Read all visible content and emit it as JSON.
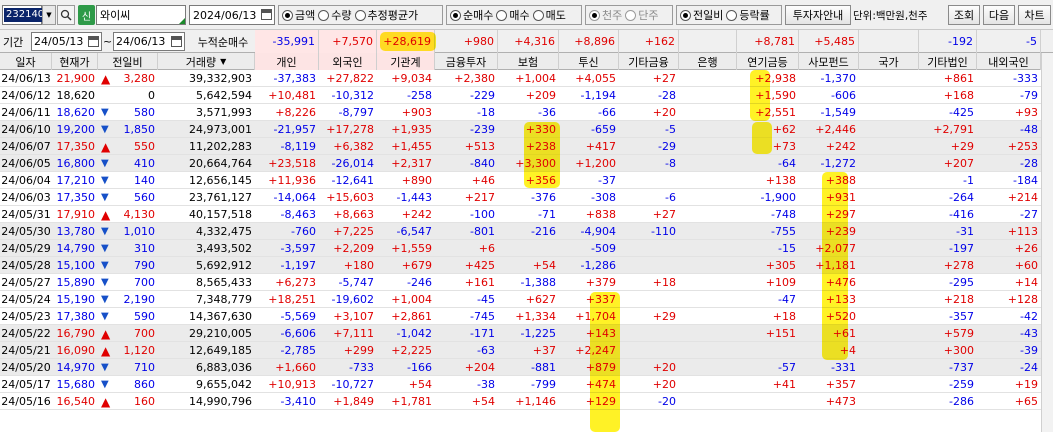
{
  "toolbar": {
    "code": "232140",
    "credit_badge": "신",
    "name": "와이씨",
    "date": "2024/06/13",
    "unit_radios": [
      {
        "label": "금액",
        "on": true
      },
      {
        "label": "수량",
        "on": false
      },
      {
        "label": "추정평균가",
        "on": false
      }
    ],
    "trade_radios": [
      {
        "label": "순매수",
        "on": true
      },
      {
        "label": "매수",
        "on": false
      },
      {
        "label": "매도",
        "on": false
      }
    ],
    "unit_radios2": [
      {
        "label": "천주",
        "on": true
      },
      {
        "label": "단주",
        "on": false
      }
    ],
    "compare_radios": [
      {
        "label": "전일비",
        "on": true
      },
      {
        "label": "등락률",
        "on": false
      }
    ],
    "investor_guide": "투자자안내",
    "unit_text": "단위:백만원,천주",
    "lookup": "조회",
    "next": "다음",
    "chart": "차트"
  },
  "period": {
    "label": "기간",
    "from": "24/05/13",
    "tilde": "~",
    "to": "24/06/13",
    "cumul_label": "누적순매수",
    "cumul": {
      "indiv": "-35,991",
      "foreign": "+7,570",
      "inst": "+28,619",
      "fininv": "+980",
      "insur": "+4,316",
      "trust": "+8,896",
      "etcfin": "+162",
      "bank": "",
      "pension": "+8,781",
      "pef": "+5,485",
      "nation": "",
      "etccorp": "-192",
      "dom": "-5"
    }
  },
  "columns": {
    "date": "일자",
    "price": "현재가",
    "change": "전일비",
    "volume": "거래량",
    "indiv": "개인",
    "foreign": "외국인",
    "inst": "기관계",
    "fininv": "금융투자",
    "insur": "보험",
    "trust": "투신",
    "etcfin": "기타금융",
    "bank": "은행",
    "pension": "연기금등",
    "pef": "사모펀드",
    "nation": "국가",
    "etccorp": "기타법인",
    "dom": "내외국인"
  },
  "rows": [
    {
      "date": "24/06/13",
      "price": "21,900",
      "dir": "up",
      "change": "3,280",
      "volume": "39,332,903",
      "indiv": "-37,383",
      "foreign": "+27,822",
      "inst": "+9,034",
      "fininv": "+2,380",
      "insur": "+1,004",
      "trust": "+4,055",
      "etcfin": "+27",
      "bank": "",
      "pension": "+2,938",
      "pef": "-1,370",
      "nation": "",
      "etccorp": "+861",
      "dom": "-333"
    },
    {
      "date": "24/06/12",
      "price": "18,620",
      "dir": "none",
      "change": "0",
      "volume": "5,642,594",
      "indiv": "+10,481",
      "foreign": "-10,312",
      "inst": "-258",
      "fininv": "-229",
      "insur": "+209",
      "trust": "-1,194",
      "etcfin": "-28",
      "bank": "",
      "pension": "+1,590",
      "pef": "-606",
      "nation": "",
      "etccorp": "+168",
      "dom": "-79"
    },
    {
      "date": "24/06/11",
      "price": "18,620",
      "dir": "down",
      "change": "580",
      "volume": "3,571,993",
      "indiv": "+8,226",
      "foreign": "-8,797",
      "inst": "+903",
      "fininv": "-18",
      "insur": "-36",
      "trust": "-66",
      "etcfin": "+20",
      "bank": "",
      "pension": "+2,551",
      "pef": "-1,549",
      "nation": "",
      "etccorp": "-425",
      "dom": "+93"
    },
    {
      "date": "24/06/10",
      "price": "19,200",
      "dir": "down",
      "change": "1,850",
      "volume": "24,973,001",
      "indiv": "-21,957",
      "foreign": "+17,278",
      "inst": "+1,935",
      "fininv": "-239",
      "insur": "+330",
      "trust": "-659",
      "etcfin": "-5",
      "bank": "",
      "pension": "+62",
      "pef": "+2,446",
      "nation": "",
      "etccorp": "+2,791",
      "dom": "-48"
    },
    {
      "date": "24/06/07",
      "price": "17,350",
      "dir": "up",
      "change": "550",
      "volume": "11,202,283",
      "indiv": "-8,119",
      "foreign": "+6,382",
      "inst": "+1,455",
      "fininv": "+513",
      "insur": "+238",
      "trust": "+417",
      "etcfin": "-29",
      "bank": "",
      "pension": "+73",
      "pef": "+242",
      "nation": "",
      "etccorp": "+29",
      "dom": "+253"
    },
    {
      "date": "24/06/05",
      "price": "16,800",
      "dir": "down",
      "change": "410",
      "volume": "20,664,764",
      "indiv": "+23,518",
      "foreign": "-26,014",
      "inst": "+2,317",
      "fininv": "-840",
      "insur": "+3,300",
      "trust": "+1,200",
      "etcfin": "-8",
      "bank": "",
      "pension": "-64",
      "pef": "-1,272",
      "nation": "",
      "etccorp": "+207",
      "dom": "-28"
    },
    {
      "date": "24/06/04",
      "price": "17,210",
      "dir": "down",
      "change": "140",
      "volume": "12,656,145",
      "indiv": "+11,936",
      "foreign": "-12,641",
      "inst": "+890",
      "fininv": "+46",
      "insur": "+356",
      "trust": "-37",
      "etcfin": "",
      "bank": "",
      "pension": "+138",
      "pef": "+388",
      "nation": "",
      "etccorp": "-1",
      "dom": "-184"
    },
    {
      "date": "24/06/03",
      "price": "17,350",
      "dir": "down",
      "change": "560",
      "volume": "23,761,127",
      "indiv": "-14,064",
      "foreign": "+15,603",
      "inst": "-1,443",
      "fininv": "+217",
      "insur": "-376",
      "trust": "-308",
      "etcfin": "-6",
      "bank": "",
      "pension": "-1,900",
      "pef": "+931",
      "nation": "",
      "etccorp": "-264",
      "dom": "+214"
    },
    {
      "date": "24/05/31",
      "price": "17,910",
      "dir": "up",
      "change": "4,130",
      "volume": "40,157,518",
      "indiv": "-8,463",
      "foreign": "+8,663",
      "inst": "+242",
      "fininv": "-100",
      "insur": "-71",
      "trust": "+838",
      "etcfin": "+27",
      "bank": "",
      "pension": "-748",
      "pef": "+297",
      "nation": "",
      "etccorp": "-416",
      "dom": "-27"
    },
    {
      "date": "24/05/30",
      "price": "13,780",
      "dir": "down",
      "change": "1,010",
      "volume": "4,332,475",
      "indiv": "-760",
      "foreign": "+7,225",
      "inst": "-6,547",
      "fininv": "-801",
      "insur": "-216",
      "trust": "-4,904",
      "etcfin": "-110",
      "bank": "",
      "pension": "-755",
      "pef": "+239",
      "nation": "",
      "etccorp": "-31",
      "dom": "+113"
    },
    {
      "date": "24/05/29",
      "price": "14,790",
      "dir": "down",
      "change": "310",
      "volume": "3,493,502",
      "indiv": "-3,597",
      "foreign": "+2,209",
      "inst": "+1,559",
      "fininv": "+6",
      "insur": "",
      "trust": "-509",
      "etcfin": "",
      "bank": "",
      "pension": "-15",
      "pef": "+2,077",
      "nation": "",
      "etccorp": "-197",
      "dom": "+26"
    },
    {
      "date": "24/05/28",
      "price": "15,100",
      "dir": "down",
      "change": "790",
      "volume": "5,692,912",
      "indiv": "-1,197",
      "foreign": "+180",
      "inst": "+679",
      "fininv": "+425",
      "insur": "+54",
      "trust": "-1,286",
      "etcfin": "",
      "bank": "",
      "pension": "+305",
      "pef": "+1,181",
      "nation": "",
      "etccorp": "+278",
      "dom": "+60"
    },
    {
      "date": "24/05/27",
      "price": "15,890",
      "dir": "down",
      "change": "700",
      "volume": "8,565,433",
      "indiv": "+6,273",
      "foreign": "-5,747",
      "inst": "-246",
      "fininv": "+161",
      "insur": "-1,388",
      "trust": "+379",
      "etcfin": "+18",
      "bank": "",
      "pension": "+109",
      "pef": "+476",
      "nation": "",
      "etccorp": "-295",
      "dom": "+14"
    },
    {
      "date": "24/05/24",
      "price": "15,190",
      "dir": "down",
      "change": "2,190",
      "volume": "7,348,779",
      "indiv": "+18,251",
      "foreign": "-19,602",
      "inst": "+1,004",
      "fininv": "-45",
      "insur": "+627",
      "trust": "+337",
      "etcfin": "",
      "bank": "",
      "pension": "-47",
      "pef": "+133",
      "nation": "",
      "etccorp": "+218",
      "dom": "+128"
    },
    {
      "date": "24/05/23",
      "price": "17,380",
      "dir": "down",
      "change": "590",
      "volume": "14,367,630",
      "indiv": "-5,569",
      "foreign": "+3,107",
      "inst": "+2,861",
      "fininv": "-745",
      "insur": "+1,334",
      "trust": "+1,704",
      "etcfin": "+29",
      "bank": "",
      "pension": "+18",
      "pef": "+520",
      "nation": "",
      "etccorp": "-357",
      "dom": "-42"
    },
    {
      "date": "24/05/22",
      "price": "16,790",
      "dir": "up",
      "change": "700",
      "volume": "29,210,005",
      "indiv": "-6,606",
      "foreign": "+7,111",
      "inst": "-1,042",
      "fininv": "-171",
      "insur": "-1,225",
      "trust": "+143",
      "etcfin": "",
      "bank": "",
      "pension": "+151",
      "pef": "+61",
      "nation": "",
      "etccorp": "+579",
      "dom": "-43"
    },
    {
      "date": "24/05/21",
      "price": "16,090",
      "dir": "up",
      "change": "1,120",
      "volume": "12,649,185",
      "indiv": "-2,785",
      "foreign": "+299",
      "inst": "+2,225",
      "fininv": "-63",
      "insur": "+37",
      "trust": "+2,247",
      "etcfin": "",
      "bank": "",
      "pension": "",
      "pef": "+4",
      "nation": "",
      "etccorp": "+300",
      "dom": "-39"
    },
    {
      "date": "24/05/20",
      "price": "14,970",
      "dir": "down",
      "change": "710",
      "volume": "6,883,036",
      "indiv": "+1,660",
      "foreign": "-733",
      "inst": "-166",
      "fininv": "+204",
      "insur": "-881",
      "trust": "+879",
      "etcfin": "+20",
      "bank": "",
      "pension": "-57",
      "pef": "-331",
      "nation": "",
      "etccorp": "-737",
      "dom": "-24"
    },
    {
      "date": "24/05/17",
      "price": "15,680",
      "dir": "down",
      "change": "860",
      "volume": "9,655,042",
      "indiv": "+10,913",
      "foreign": "-10,727",
      "inst": "+54",
      "fininv": "-38",
      "insur": "-799",
      "trust": "+474",
      "etcfin": "+20",
      "bank": "",
      "pension": "+41",
      "pef": "+357",
      "nation": "",
      "etccorp": "-259",
      "dom": "+19"
    },
    {
      "date": "24/05/16",
      "price": "16,540",
      "dir": "up",
      "change": "160",
      "volume": "14,990,796",
      "indiv": "-3,410",
      "foreign": "+1,849",
      "inst": "+1,781",
      "fininv": "+54",
      "insur": "+1,146",
      "trust": "+129",
      "etcfin": "-20",
      "bank": "",
      "pension": "",
      "pef": "+473",
      "nation": "",
      "etccorp": "-286",
      "dom": "+65"
    }
  ],
  "colors": {
    "positive": "#e00000",
    "negative": "#0000e8",
    "highlight": "#fff200",
    "shade": "#ebebeb"
  }
}
